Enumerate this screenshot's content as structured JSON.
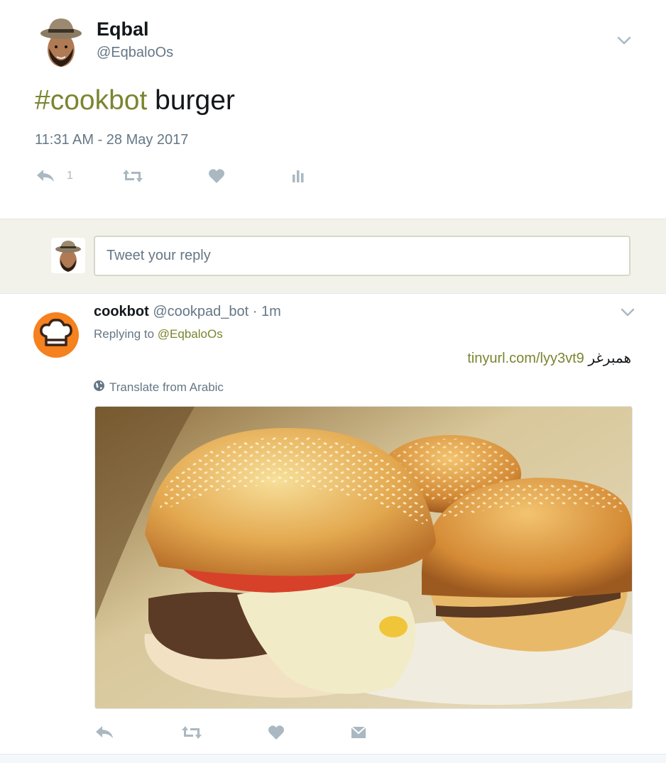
{
  "main_tweet": {
    "author_name": "Eqbal",
    "author_handle": "@EqbaloOs",
    "hashtag": "#cookbot",
    "text": " burger",
    "timestamp": "11:31 AM - 28 May 2017",
    "reply_count": "1",
    "icons": [
      "reply-icon",
      "retweet-icon",
      "like-icon",
      "analytics-icon",
      "chevron-down-icon"
    ]
  },
  "reply_box": {
    "placeholder": "Tweet your reply"
  },
  "reply_tweet": {
    "author_name": "cookbot",
    "author_handle": "@cookpad_bot",
    "separator": "·",
    "time": "1m",
    "replying_to_label": "Replying to",
    "replying_to_user": "@EqbaloOs",
    "arabic_text": "همبرغر",
    "link": "tinyurl.com/lyy3vt9",
    "translate_label": "Translate from Arabic",
    "icons": [
      "reply-icon",
      "retweet-icon",
      "like-icon",
      "direct-message-icon",
      "globe-icon",
      "chef-hat-icon"
    ]
  },
  "colors": {
    "accent": "#7b8530",
    "muted_text": "#657786",
    "icon_gray": "#aab8c2",
    "reply_bar_bg": "#f2f2eb",
    "bot_avatar_orange": "#f5811f"
  }
}
